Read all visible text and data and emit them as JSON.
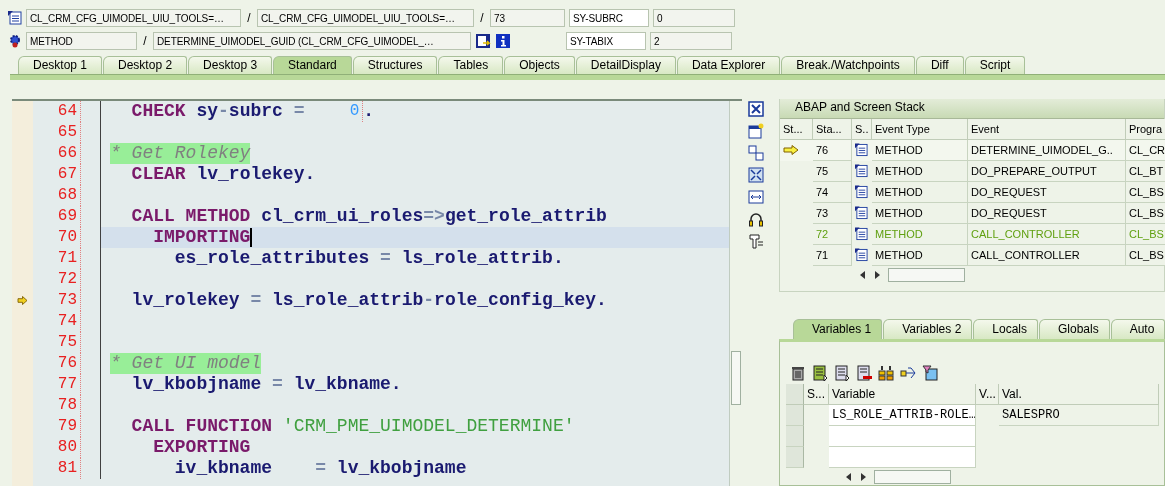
{
  "header": {
    "row_1": {
      "program": "CL_CRM_CFG_UIMODEL_UIU_TOOLS=…",
      "include": "CL_CRM_CFG_UIMODEL_UIU_TOOLS=…",
      "line": "73",
      "var_name": "SY-SUBRC",
      "var_value": "0"
    },
    "row_2": {
      "event_type": "METHOD",
      "event": "DETERMINE_UIMODEL_GUID (CL_CRM_CFG_UIMODEL_…",
      "var_name": "SY-TABIX",
      "var_value": "2"
    },
    "separator": "/"
  },
  "tabs": [
    {
      "label": "Desktop 1",
      "selected": false
    },
    {
      "label": "Desktop 2",
      "selected": false
    },
    {
      "label": "Desktop 3",
      "selected": false
    },
    {
      "label": "Standard",
      "selected": true
    },
    {
      "label": "Structures",
      "selected": false
    },
    {
      "label": "Tables",
      "selected": false
    },
    {
      "label": "Objects",
      "selected": false
    },
    {
      "label": "DetailDisplay",
      "selected": false
    },
    {
      "label": "Data Explorer",
      "selected": false
    },
    {
      "label": "Break./Watchpoints",
      "selected": false
    },
    {
      "label": "Diff",
      "selected": false
    },
    {
      "label": "Script",
      "selected": false
    }
  ],
  "editor": {
    "lines": [
      {
        "number": "64",
        "cursor": false,
        "executing": false,
        "tokens": [
          {
            "kind": "kw",
            "text": "  CHECK"
          },
          {
            "kind": "id",
            "text": " sy"
          },
          {
            "kind": "op",
            "text": "-"
          },
          {
            "kind": "id",
            "text": "subrc"
          },
          {
            "kind": "op",
            "text": " = "
          },
          {
            "kind": "num",
            "text": "0"
          },
          {
            "kind": "id",
            "text": "."
          }
        ]
      },
      {
        "number": "65",
        "cursor": false,
        "executing": false
      },
      {
        "number": "66",
        "cursor": false,
        "executing": false,
        "tokens": [
          {
            "kind": "comment",
            "text": "* Get Rolekey"
          }
        ]
      },
      {
        "number": "67",
        "cursor": false,
        "executing": false,
        "tokens": [
          {
            "kind": "kw",
            "text": "  CLEAR"
          },
          {
            "kind": "id",
            "text": " lv_rolekey."
          }
        ]
      },
      {
        "number": "68",
        "cursor": false,
        "executing": false
      },
      {
        "number": "69",
        "cursor": false,
        "executing": false,
        "tokens": [
          {
            "kind": "kw",
            "text": "  CALL METHOD"
          },
          {
            "kind": "id",
            "text": " cl_crm_ui_roles"
          },
          {
            "kind": "op",
            "text": "=>"
          },
          {
            "kind": "id",
            "text": "get_role_attrib"
          }
        ]
      },
      {
        "number": "70",
        "cursor": true,
        "executing": false,
        "tokens": [
          {
            "kind": "kw",
            "text": "    IMPORTING"
          }
        ]
      },
      {
        "number": "71",
        "cursor": false,
        "executing": false,
        "tokens": [
          {
            "kind": "id",
            "text": "      es_role_attributes"
          },
          {
            "kind": "op",
            "text": " = "
          },
          {
            "kind": "id",
            "text": "ls_role_attrib."
          }
        ]
      },
      {
        "number": "72",
        "cursor": false,
        "executing": false
      },
      {
        "number": "73",
        "cursor": false,
        "executing": true,
        "tokens": [
          {
            "kind": "id",
            "text": "  lv_rolekey"
          },
          {
            "kind": "op",
            "text": " = "
          },
          {
            "kind": "id",
            "text": "ls_role_attrib"
          },
          {
            "kind": "op",
            "text": "-"
          },
          {
            "kind": "id",
            "text": "role_config_key."
          }
        ]
      },
      {
        "number": "74",
        "cursor": false,
        "executing": false
      },
      {
        "number": "75",
        "cursor": false,
        "executing": false
      },
      {
        "number": "76",
        "cursor": false,
        "executing": false,
        "tokens": [
          {
            "kind": "comment",
            "text": "* Get UI model"
          }
        ]
      },
      {
        "number": "77",
        "cursor": false,
        "executing": false,
        "tokens": [
          {
            "kind": "id",
            "text": "  lv_kbobjname"
          },
          {
            "kind": "op",
            "text": " = "
          },
          {
            "kind": "id",
            "text": "lv_kbname."
          }
        ]
      },
      {
        "number": "78",
        "cursor": false,
        "executing": false
      },
      {
        "number": "79",
        "cursor": false,
        "executing": false,
        "tokens": [
          {
            "kind": "kw",
            "text": "  CALL FUNCTION"
          },
          {
            "kind": "str",
            "text": " 'CRM_PME_UIMODEL_DETERMINE'"
          }
        ]
      },
      {
        "number": "80",
        "cursor": false,
        "executing": false,
        "tokens": [
          {
            "kind": "kw",
            "text": "    EXPORTING"
          }
        ]
      },
      {
        "number": "81",
        "cursor": false,
        "executing": false,
        "tokens": [
          {
            "kind": "id",
            "text": "      iv_kbname"
          },
          {
            "kind": "op",
            "text": "    = "
          },
          {
            "kind": "id",
            "text": "lv_kbobjname"
          }
        ]
      }
    ]
  },
  "stack": {
    "title": "ABAP and Screen Stack",
    "columns": [
      "St...",
      "Sta...",
      "S..",
      "Event Type",
      "Event",
      "Progra"
    ],
    "rows": [
      {
        "current": true,
        "highlighted": false,
        "level": "76",
        "event_type": "METHOD",
        "event": "DETERMINE_UIMODEL_G..",
        "program": "CL_CR"
      },
      {
        "current": false,
        "highlighted": false,
        "level": "75",
        "event_type": "METHOD",
        "event": "DO_PREPARE_OUTPUT",
        "program": "CL_BT"
      },
      {
        "current": false,
        "highlighted": false,
        "level": "74",
        "event_type": "METHOD",
        "event": "DO_REQUEST",
        "program": "CL_BS"
      },
      {
        "current": false,
        "highlighted": false,
        "level": "73",
        "event_type": "METHOD",
        "event": "DO_REQUEST",
        "program": "CL_BS"
      },
      {
        "current": false,
        "highlighted": true,
        "level": "72",
        "event_type": "METHOD",
        "event": "CALL_CONTROLLER",
        "program": "CL_BS"
      },
      {
        "current": false,
        "highlighted": false,
        "level": "71",
        "event_type": "METHOD",
        "event": "CALL_CONTROLLER",
        "program": "CL_BS"
      }
    ]
  },
  "variables": {
    "tabs": [
      {
        "label": "Variables 1",
        "selected": true
      },
      {
        "label": "Variables 2",
        "selected": false
      },
      {
        "label": "Locals",
        "selected": false
      },
      {
        "label": "Globals",
        "selected": false
      },
      {
        "label": "Auto",
        "selected": false
      }
    ],
    "columns": [
      "S...",
      "Variable",
      "V...",
      "Val."
    ],
    "rows": [
      {
        "variable": "LS_ROLE_ATTRIB-ROLE…",
        "value": "SALESPRO"
      }
    ]
  }
}
